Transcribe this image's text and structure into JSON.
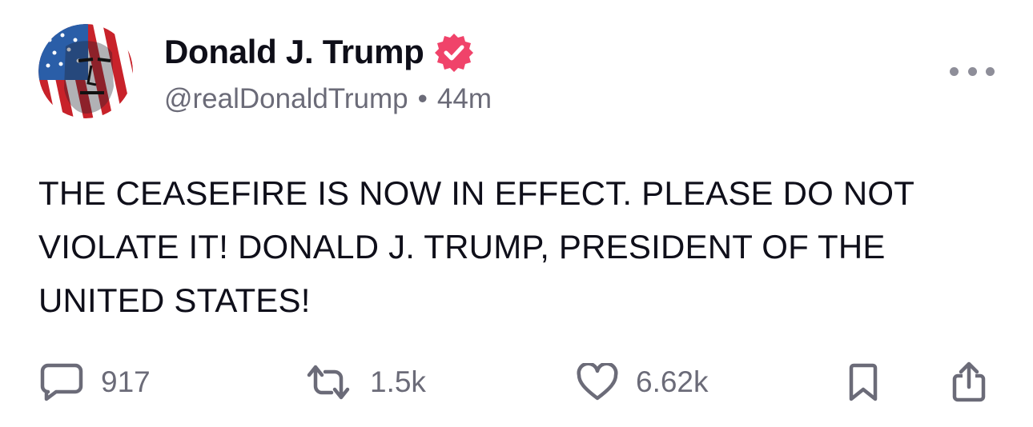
{
  "author": {
    "display_name": "Donald J. Trump",
    "handle": "@realDonaldTrump",
    "separator": "•",
    "timestamp": "44m",
    "verified": true,
    "verified_badge_color": "#f0436a"
  },
  "post": {
    "text": "THE CEASEFIRE IS NOW IN EFFECT. PLEASE DO NOT VIOLATE IT! DONALD J. TRUMP, PRESIDENT OF THE UNITED STATES!"
  },
  "actions": {
    "replies": "917",
    "reposts": "1.5k",
    "likes": "6.62k"
  },
  "icons": {
    "reply": "speech-bubble-icon",
    "repost": "repost-arrows-icon",
    "like": "heart-icon",
    "bookmark": "bookmark-icon",
    "share": "share-icon",
    "more": "ellipsis-icon"
  },
  "colors": {
    "text": "#0f0f1a",
    "muted": "#6b6b78",
    "accent": "#f0436a"
  }
}
